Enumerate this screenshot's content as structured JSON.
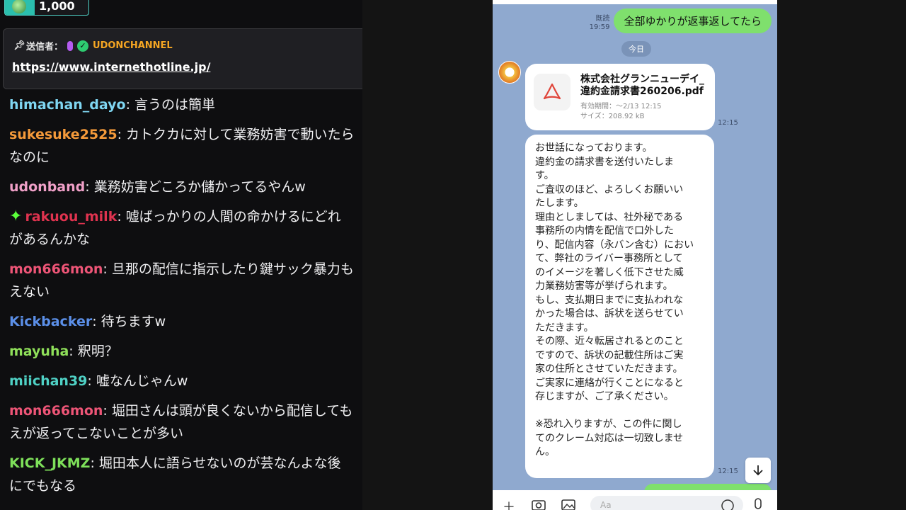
{
  "stream_chat": {
    "badge_amount": "1,000",
    "pinned": {
      "sender_label": "送信者：",
      "channel_name": "UDONCHANNEL",
      "link": "https://www.internethotline.jp/"
    },
    "messages": [
      {
        "user": "himachan_dayo",
        "color": "#7fd6f2",
        "text": "言うのは簡単",
        "cont": ""
      },
      {
        "user": "sukesuke2525",
        "color": "#f59a3a",
        "text": "カトクカに対して業務妨害で動いたら",
        "cont": "なのに"
      },
      {
        "user": "udonband",
        "color": "#f0a0c8",
        "text": "業務妨害どころか儲かってるやんw",
        "cont": ""
      },
      {
        "user": "rakuou_milk",
        "color": "#e0334f",
        "text": "嘘ばっかりの人間の命かけるにどれ",
        "cont": "があるんかな"
      },
      {
        "user": "mon666mon",
        "color": "#ee5577",
        "text": "旦那の配信に指示したり鍵サック暴力も",
        "cont": "えない"
      },
      {
        "user": "Kickbacker",
        "color": "#5b8fe8",
        "text": "待ちますw",
        "cont": ""
      },
      {
        "user": "mayuha",
        "color": "#8fe05a",
        "text": "釈明？",
        "cont": ""
      },
      {
        "user": "miichan39",
        "color": "#4fd1c5",
        "text": "嘘なんじゃんw",
        "cont": ""
      },
      {
        "user": "mon666mon",
        "color": "#ee5577",
        "text": "堀田さんは頭が良くないから配信しても",
        "cont": "えが返ってこないことが多い"
      },
      {
        "user": "KICK_JKMZ",
        "color": "#7ee05a",
        "text": "堀田本人に語らせないのが芸なんよな後",
        "cont": "にでもなる"
      }
    ]
  },
  "line_chat": {
    "sent_message": {
      "read_label": "既読",
      "time": "19:59",
      "text": "全部ゆかりが返事返してたら"
    },
    "date_divider": "今日",
    "file": {
      "name": "株式会社グランニューデイ_違約金請求書260206.pdf",
      "expiry": "有効期間：～2/13 12:15",
      "size": "サイズ：208.92 kB",
      "time": "12:15"
    },
    "message_time": "12:15",
    "message_lines": [
      "お世話になっております。",
      "違約金の請求書を送付いたしま",
      "す。",
      "ご査収のほど、よろしくお願いい",
      "たします。",
      "理由としましては、社外秘である",
      "事務所の内情を配信で口外した",
      "り、配信内容（永バン含む）におい",
      "て、弊社のライバー事務所として",
      "のイメージを著しく低下させた威",
      "力業務妨害等が挙げられます。",
      "もし、支払期日までに支払われな",
      "かった場合は、訴状を送らせてい",
      "ただきます。",
      "その際、近々転居されるとのこと",
      "ですので、訴状の記載住所はご実",
      "家の住所とさせていただきます。",
      "ご実家に連絡が行くことになると",
      "存じますが、ご了承ください。",
      "",
      "※恐れ入りますが、この件に関し",
      "てのクレーム対応は一切致しませ",
      "ん。"
    ],
    "input_placeholder": "Aa"
  }
}
